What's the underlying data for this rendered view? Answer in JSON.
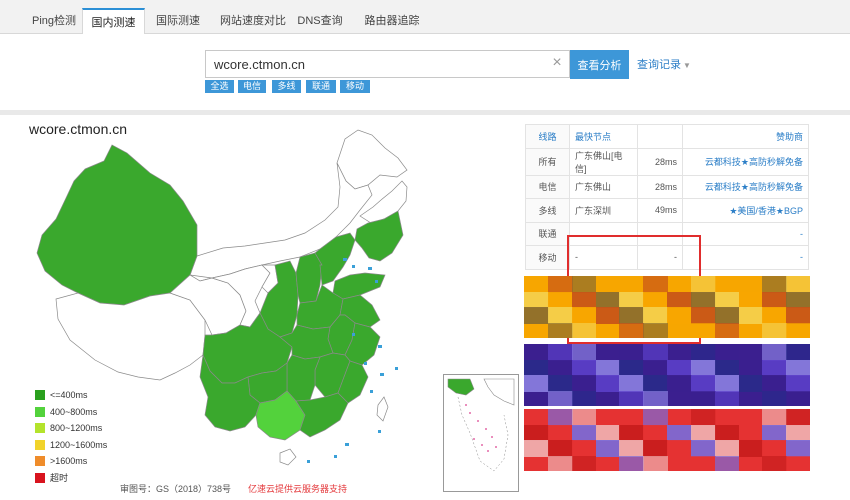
{
  "tabs": [
    {
      "label": "Ping检测"
    },
    {
      "label": "国内测速"
    },
    {
      "label": "国际测速"
    },
    {
      "label": "网站速度对比"
    },
    {
      "label": "DNS查询"
    },
    {
      "label": "路由器追踪"
    }
  ],
  "active_tab": "国内测速",
  "search": {
    "value": "wcore.ctmon.cn",
    "clear_icon": "close-icon",
    "submit_label": "查看分析",
    "history_label": "查询记录"
  },
  "filters": [
    {
      "label": "全选"
    },
    {
      "label": "电信"
    },
    {
      "label": "多线"
    },
    {
      "label": "联通"
    },
    {
      "label": "移动"
    }
  ],
  "map": {
    "title": "wcore.ctmon.cn",
    "colors": {
      "fast": "#3aa82d",
      "medium": "#53d23c",
      "empty": "#ffffff",
      "border": "#8a8a8a",
      "accent_red": "#e02d2d",
      "accent_blue": "#3d97d8"
    },
    "legend": [
      {
        "label": "<=400ms",
        "color": "#2aa01e"
      },
      {
        "label": "400~800ms",
        "color": "#53d23c"
      },
      {
        "label": "800~1200ms",
        "color": "#b4e32c"
      },
      {
        "label": "1200~1600ms",
        "color": "#f1d32b"
      },
      {
        "label": ">1600ms",
        "color": "#ef8c2a"
      },
      {
        "label": "超时",
        "color": "#d8141e"
      }
    ],
    "map_credit": "审图号：GS（2018）738号",
    "cloud_credit": "亿速云提供云服务器支持"
  },
  "results": {
    "header": {
      "line": "线路",
      "node": "最快节点",
      "time": "",
      "sponsor": "赞助商"
    },
    "rows": [
      {
        "line": "所有",
        "node": "广东佛山[电信]",
        "time": "28ms",
        "sponsor": "云都科技★高防秒解免备"
      },
      {
        "line": "电信",
        "node": "广东佛山",
        "time": "28ms",
        "sponsor": "云都科技★高防秒解免备"
      },
      {
        "line": "多线",
        "node": "广东深圳",
        "time": "49ms",
        "sponsor": "★美国/香港★BGP"
      },
      {
        "line": "联通",
        "node": "",
        "time": "",
        "sponsor": "-"
      },
      {
        "line": "移动",
        "node": "-",
        "time": "-",
        "sponsor": "-"
      }
    ]
  },
  "ads": [
    {
      "name": "banner-ad-1",
      "colors": [
        "#f7a600",
        "#c75418",
        "#8a6c2e",
        "#f4d04d"
      ]
    },
    {
      "name": "banner-ad-2",
      "colors": [
        "#3b1f8f",
        "#5b3fc8",
        "#8a7ee0",
        "#2a2a8a"
      ]
    },
    {
      "name": "banner-ad-3",
      "colors": [
        "#e53232",
        "#7a6ad8",
        "#f0b0b0",
        "#c81c1c"
      ]
    }
  ]
}
